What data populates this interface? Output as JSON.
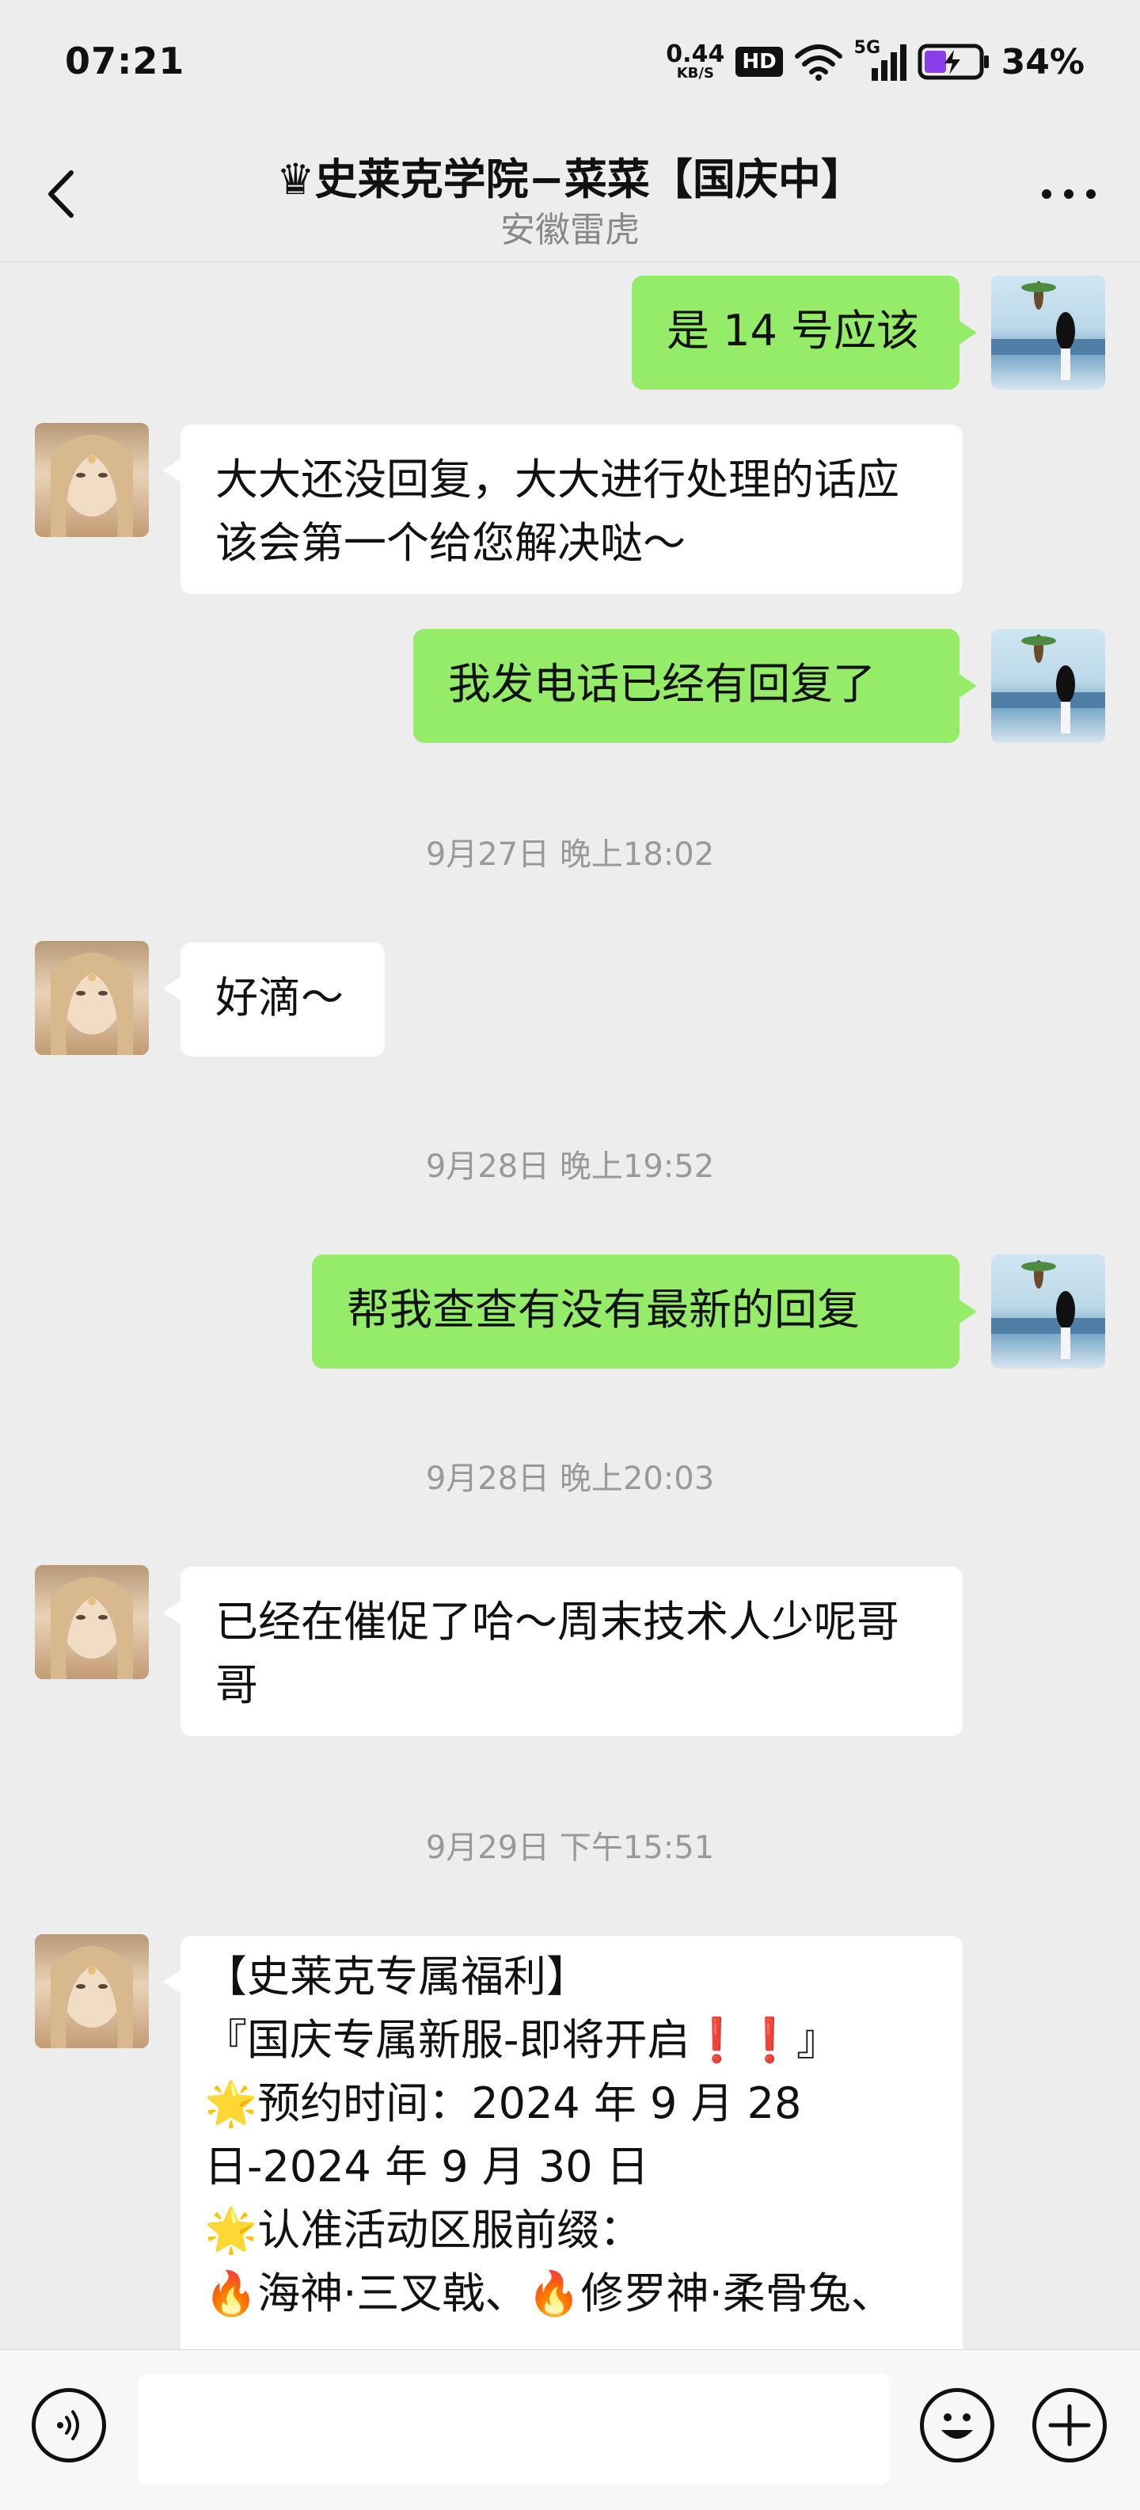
{
  "status_bar": {
    "time": "07:21",
    "net_speed_value": "0.44",
    "net_speed_unit": "KB/S",
    "hd_badge": "HD",
    "signal_label": "5G",
    "battery_percent": "34%",
    "battery_color": "#8a3ee8"
  },
  "header": {
    "title": "♛史莱克学院−菜菜【国庆中】",
    "subtitle": "安徽雷虎"
  },
  "messages": [
    {
      "side": "me",
      "text": "是 14 号应该"
    },
    {
      "side": "them",
      "text": "大大还没回复，大大进行处理的话应该会第一个给您解决哒～"
    },
    {
      "side": "me",
      "text": "我发电话已经有回复了"
    },
    {
      "side": "time",
      "text": "9月27日 晚上18:02"
    },
    {
      "side": "them",
      "text": "好滴～"
    },
    {
      "side": "time",
      "text": "9月28日 晚上19:52"
    },
    {
      "side": "me",
      "text": "帮我查查有没有最新的回复"
    },
    {
      "side": "time",
      "text": "9月28日 晚上20:03"
    },
    {
      "side": "them",
      "text": "已经在催促了哈～周末技术人少呢哥哥"
    },
    {
      "side": "time",
      "text": "9月29日 下午15:51"
    },
    {
      "side": "them",
      "text": "【史莱克专属福利】\n『国庆专属新服-即将开启❗❗』\n🌟预约时间：2024 年 9 月 28 日-2024 年 9 月 30 日\n🌟认准活动区服前缀：\n🔥海神·三叉戟、🔥修罗神·柔骨兔、"
    }
  ],
  "input_bar": {
    "voice_icon": "voice-icon",
    "emoji_icon": "emoji-icon",
    "plus_icon": "plus-icon"
  },
  "colors": {
    "my_bubble": "#95ec69",
    "their_bubble": "#ffffff",
    "background": "#ededed"
  }
}
